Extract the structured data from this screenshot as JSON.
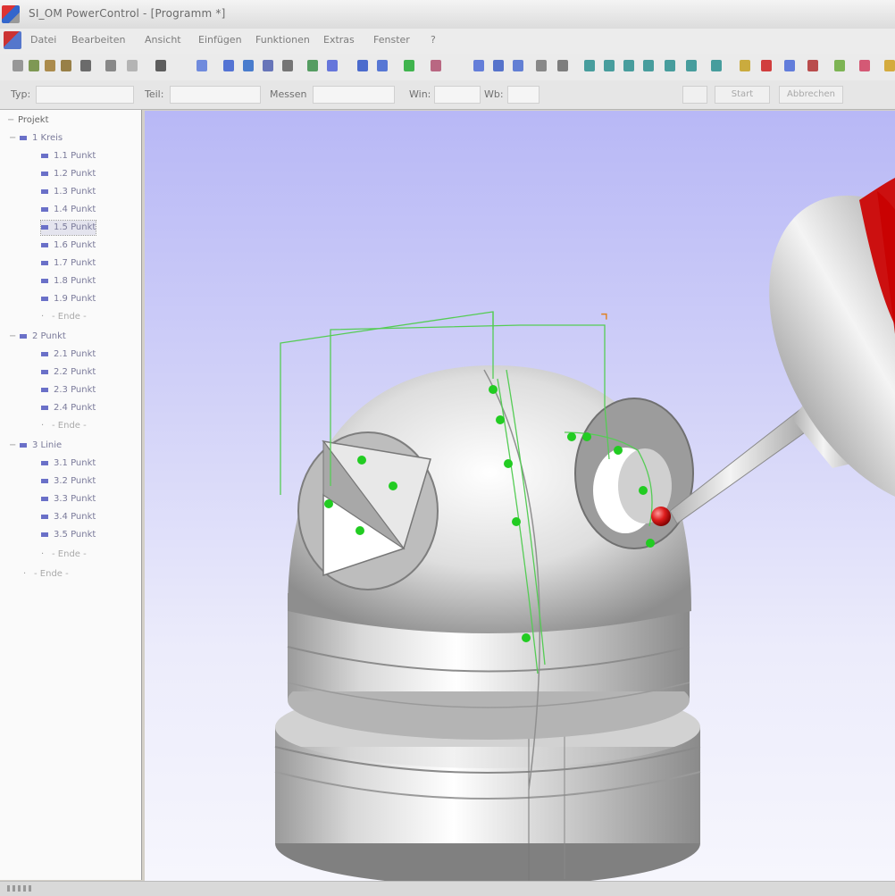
{
  "window": {
    "title": "SI_OM PowerControl - [Programm *]"
  },
  "menu": [
    "Datei",
    "Bearbeiten",
    "Ansicht",
    "Einfügen",
    "Funktionen",
    "Extras",
    "Fenster",
    "?"
  ],
  "toolbar2": {
    "label1": "Typ:",
    "label2": "Teil:",
    "label3": "Messen",
    "label4": "Win:",
    "label5": "Wb:",
    "btn_run": "Start",
    "btn_stop": "Abbrechen"
  },
  "tree": {
    "root": "Projekt",
    "groups": [
      {
        "label": "1 Kreis",
        "items": [
          "1.1 Punkt",
          "1.2 Punkt",
          "1.3 Punkt",
          "1.4 Punkt",
          "1.5 Punkt",
          "1.6 Punkt",
          "1.7 Punkt",
          "1.8 Punkt",
          "1.9 Punkt",
          "- Ende -"
        ]
      },
      {
        "label": "2 Punkt",
        "items": [
          "2.1 Punkt",
          "2.2 Punkt",
          "2.3 Punkt",
          "2.4 Punkt",
          "- Ende -"
        ]
      },
      {
        "label": "3 Linie",
        "items": [
          "3.1 Punkt",
          "3.2 Punkt",
          "3.3 Punkt",
          "3.4 Punkt",
          "3.5 Punkt",
          "- Ende -"
        ]
      }
    ],
    "end": "- Ende -"
  },
  "colors": {
    "accent_red": "#cc1010",
    "probe_point": "#22cc22",
    "path_line": "#55cc55",
    "viewport_top": "#b8b8f6",
    "viewport_bottom": "#f6f6fd"
  },
  "icons": [
    "new-icon",
    "open-icon",
    "save-icon",
    "print-icon",
    "cut-icon",
    "copy-icon",
    "paste-icon",
    "measure-icon",
    "probe-icon",
    "view-icon"
  ]
}
